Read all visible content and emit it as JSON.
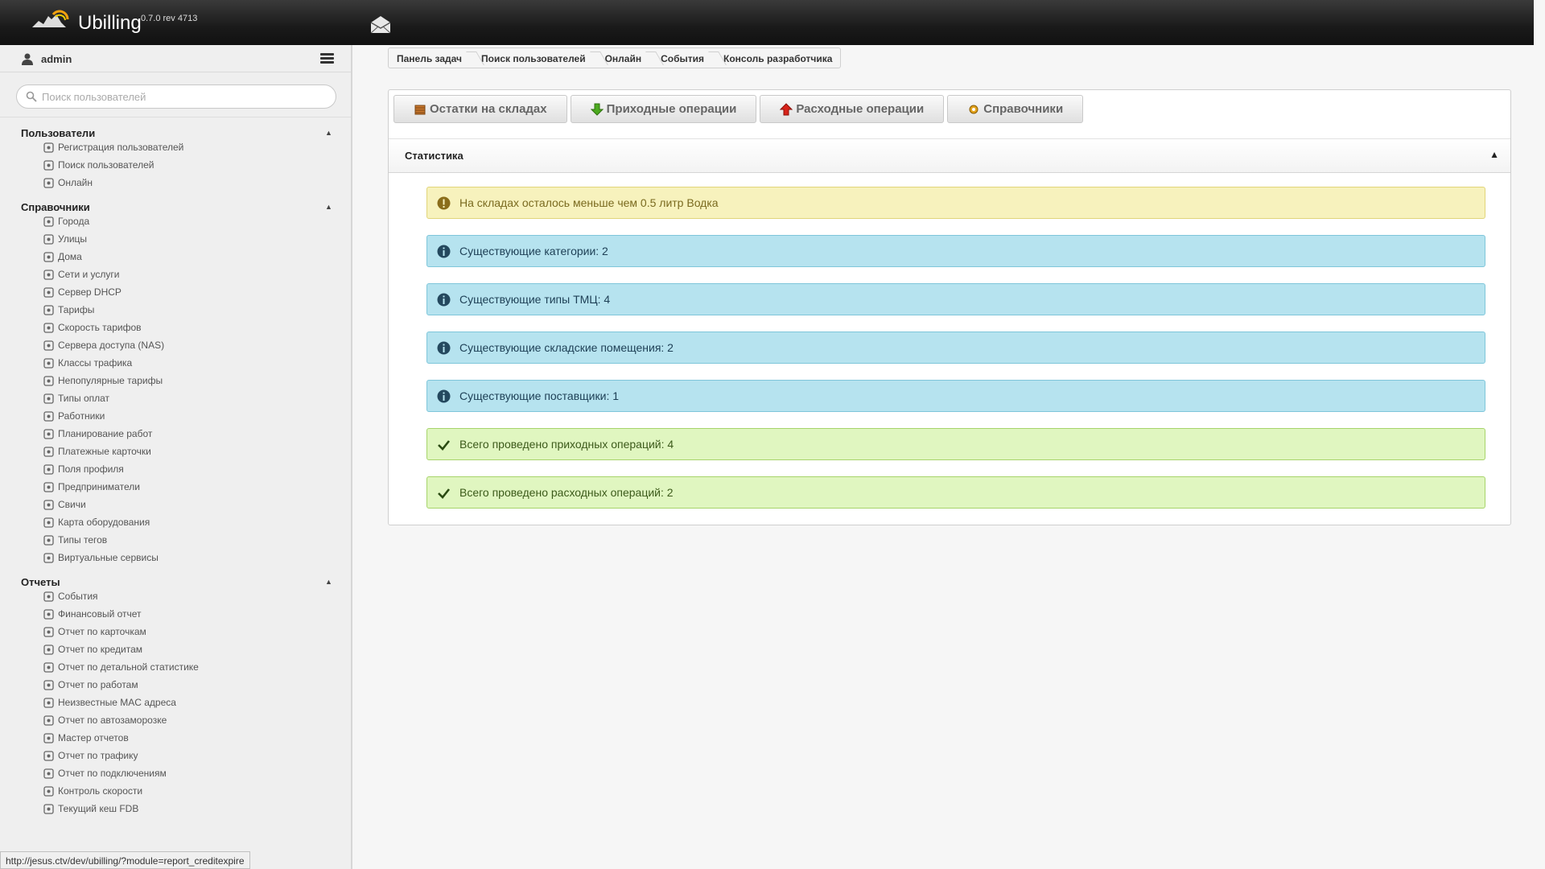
{
  "app": {
    "brand": "Ubilling",
    "version": "0.7.0 rev 4713"
  },
  "user": {
    "name": "admin"
  },
  "search": {
    "placeholder": "Поиск пользователей"
  },
  "sidebar": {
    "sections": [
      {
        "title": "Пользователи",
        "items": [
          {
            "label": "Регистрация пользователей",
            "icon": "user-add-icon"
          },
          {
            "label": "Поиск пользователей",
            "icon": "magnifier-icon"
          },
          {
            "label": "Онлайн",
            "icon": "users-online-icon"
          }
        ]
      },
      {
        "title": "Справочники",
        "items": [
          {
            "label": "Города",
            "icon": "city-icon"
          },
          {
            "label": "Улицы",
            "icon": "street-icon"
          },
          {
            "label": "Дома",
            "icon": "house-icon"
          },
          {
            "label": "Сети и услуги",
            "icon": "network-icon"
          },
          {
            "label": "Сервер DHCP",
            "icon": "server-icon"
          },
          {
            "label": "Тарифы",
            "icon": "dollar-icon"
          },
          {
            "label": "Скорость тарифов",
            "icon": "speedometer-icon"
          },
          {
            "label": "Сервера доступа (NAS)",
            "icon": "nas-icon"
          },
          {
            "label": "Классы трафика",
            "icon": "traffic-light-icon"
          },
          {
            "label": "Непопулярные тарифы",
            "icon": "unpopular-icon"
          },
          {
            "label": "Типы оплат",
            "icon": "payment-icon"
          },
          {
            "label": "Работники",
            "icon": "worker-icon"
          },
          {
            "label": "Планирование работ",
            "icon": "planning-icon"
          },
          {
            "label": "Платежные карточки",
            "icon": "card-icon"
          },
          {
            "label": "Поля профиля",
            "icon": "profile-fields-icon"
          },
          {
            "label": "Предприниматели",
            "icon": "clock-icon"
          },
          {
            "label": "Свичи",
            "icon": "switch-icon"
          },
          {
            "label": "Карта оборудования",
            "icon": "map-icon"
          },
          {
            "label": "Типы тегов",
            "icon": "tag-icon"
          },
          {
            "label": "Виртуальные сервисы",
            "icon": "virtual-service-icon"
          }
        ]
      },
      {
        "title": "Отчеты",
        "items": [
          {
            "label": "События",
            "icon": "check-circle-icon"
          },
          {
            "label": "Финансовый отчет",
            "icon": "finance-icon"
          },
          {
            "label": "Отчет по карточкам",
            "icon": "cards-report-icon"
          },
          {
            "label": "Отчет по кредитам",
            "icon": "credit-icon"
          },
          {
            "label": "Отчет по детальной статистике",
            "icon": "sigma-icon"
          },
          {
            "label": "Отчет по работам",
            "icon": "works-icon"
          },
          {
            "label": "Неизвестные MAC адреса",
            "icon": "mac-icon"
          },
          {
            "label": "Отчет по автозаморозке",
            "icon": "snowflake-icon"
          },
          {
            "label": "Мастер отчетов",
            "icon": "report-master-icon"
          },
          {
            "label": "Отчет по трафику",
            "icon": "truck-icon"
          },
          {
            "label": "Отчет по подключениям",
            "icon": "connections-icon"
          },
          {
            "label": "Контроль скорости",
            "icon": "speed-control-icon"
          },
          {
            "label": "Текущий кеш FDB",
            "icon": "fdb-icon"
          }
        ]
      }
    ]
  },
  "breadcrumb": [
    "Панель задач",
    "Поиск пользователей",
    "Онлайн",
    "События",
    "Консоль разработчика"
  ],
  "tabs": [
    {
      "label": "Остатки на складах",
      "icon": "warehouse-icon"
    },
    {
      "label": "Приходные операции",
      "icon": "arrow-down-green-icon"
    },
    {
      "label": "Расходные операции",
      "icon": "arrow-up-red-icon"
    },
    {
      "label": "Справочники",
      "icon": "gear-icon"
    }
  ],
  "stats": {
    "title": "Статистика",
    "alerts": [
      {
        "type": "warn",
        "text": "На складах осталось меньше чем 0.5 литр Водка"
      },
      {
        "type": "info",
        "text": "Существующие категории: 2"
      },
      {
        "type": "info",
        "text": "Существующие типы ТМЦ: 4"
      },
      {
        "type": "info",
        "text": "Существующие складские помещения: 2"
      },
      {
        "type": "info",
        "text": "Существующие поставщики: 1"
      },
      {
        "type": "ok",
        "text": "Всего проведено приходных операций: 4"
      },
      {
        "type": "ok",
        "text": "Всего проведено расходных операций: 2"
      }
    ]
  },
  "statusbar": {
    "url": "http://jesus.ctv/dev/ubilling/?module=report_creditexpire"
  },
  "colors": {
    "topbar": "#1a1a1a",
    "warn_bg": "#f7f2bd",
    "info_bg": "#b6e3ef",
    "ok_bg": "#e0f6c0",
    "info_icon": "#24485e",
    "ok_icon": "#2a4a12",
    "warn_icon": "#8a6d1a"
  }
}
